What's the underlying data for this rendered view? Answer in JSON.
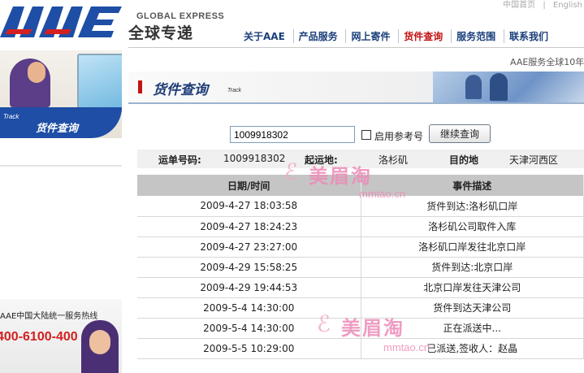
{
  "header": {
    "brand_en": "GLOBAL EXPRESS",
    "brand_cn": "全球专递",
    "top_links": [
      "中国首页",
      "|",
      "English"
    ],
    "nav": [
      {
        "label": "关于AAE",
        "active": false
      },
      {
        "label": "产品服务",
        "active": false
      },
      {
        "label": "网上寄件",
        "active": false
      },
      {
        "label": "货件查询",
        "active": true
      },
      {
        "label": "服务范围",
        "active": false
      },
      {
        "label": "联系我们",
        "active": false
      }
    ]
  },
  "left": {
    "banner_en": "Track",
    "banner_cn": "货件查询",
    "hotline_label": "AAE中国大陆统一服务热线",
    "hotline_number": "400-6100-400"
  },
  "slogan": "AAE服务全球10年",
  "section": {
    "title": "货件查询",
    "subtitle": "Track"
  },
  "search": {
    "tracking_number": "1009918302",
    "checkbox_label": "启用参考号",
    "button_label": "继续查询"
  },
  "summary": {
    "waybill_label": "运单号码:",
    "waybill_value": "1009918302",
    "origin_label": "起运地:",
    "origin_value": "洛杉矶",
    "destination_label": "目的地",
    "destination_value": "天津河西区"
  },
  "events": {
    "headers": [
      "日期/时间",
      "事件描述"
    ],
    "rows": [
      [
        "2009-4-27 18:03:58",
        "货件到达:洛杉矶口岸"
      ],
      [
        "2009-4-27 18:24:23",
        "洛杉矶公司取件入库"
      ],
      [
        "2009-4-27 23:27:00",
        "洛杉矶口岸发往北京口岸"
      ],
      [
        "2009-4-29 15:58:25",
        "货件到达:北京口岸"
      ],
      [
        "2009-4-29 19:44:53",
        "北京口岸发往天津公司"
      ],
      [
        "2009-5-4 14:30:00",
        "货件到达天津公司"
      ],
      [
        "2009-5-4 14:30:00",
        "正在派送中..."
      ],
      [
        "2009-5-5 10:29:00",
        "已派送,签收人：赵晶"
      ]
    ]
  },
  "watermark": {
    "cn": "美眉淘",
    "url": "mmtao.cn"
  },
  "colors": {
    "brand_blue": "#1e4ea6",
    "nav_text": "#1a3f7a",
    "active_red": "#c41313",
    "table_header": "#c5c5c5"
  }
}
